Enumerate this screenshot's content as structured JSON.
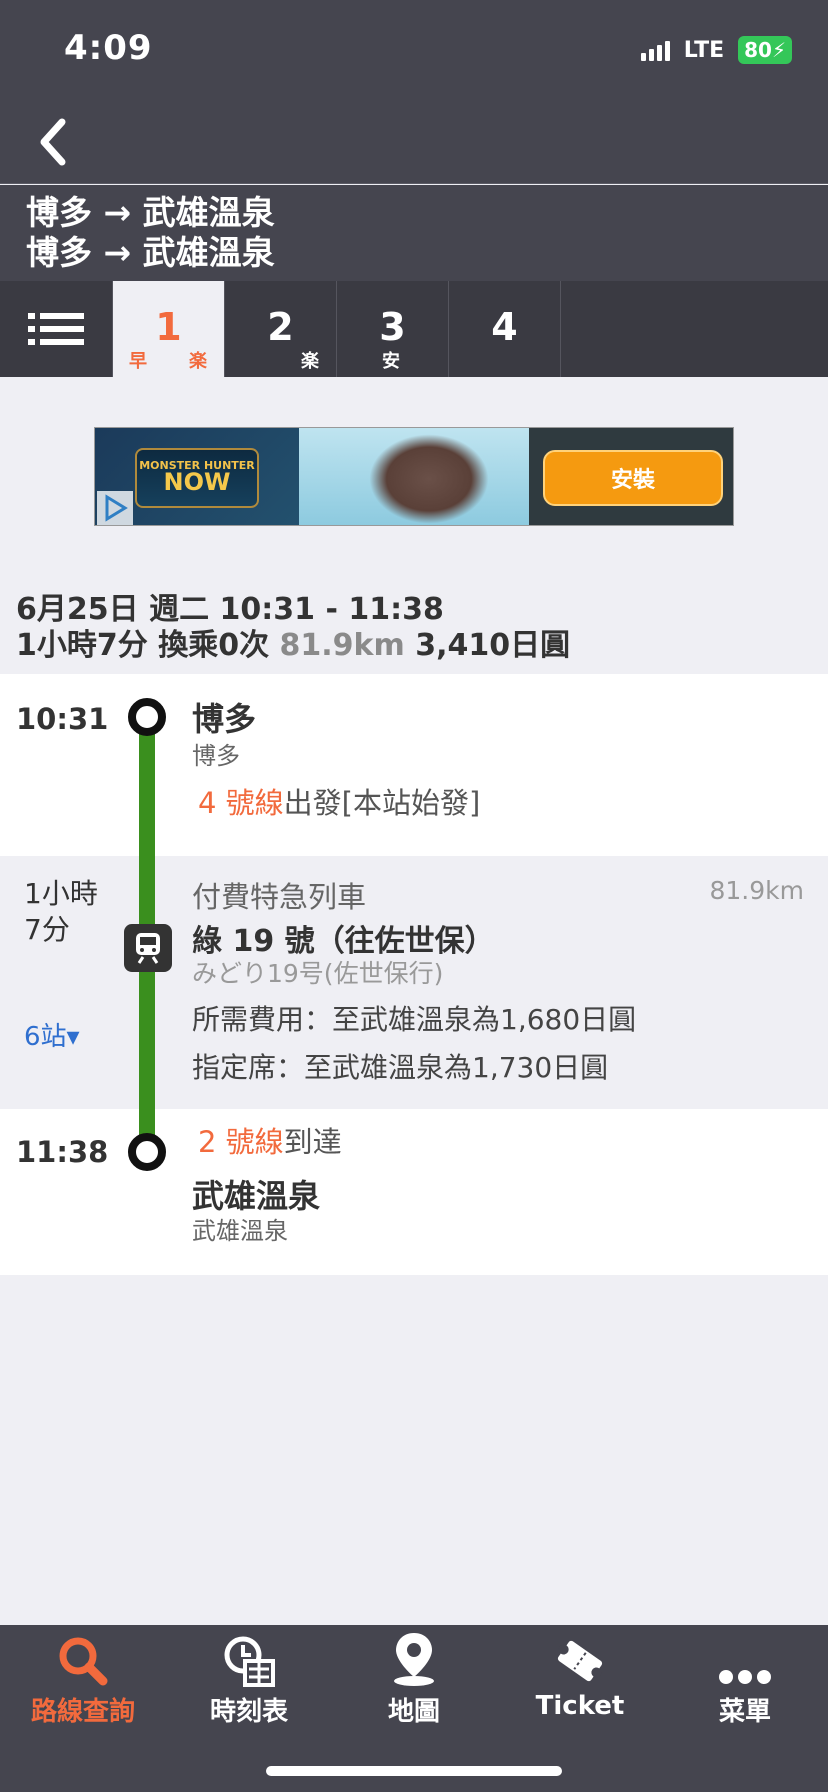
{
  "status_bar": {
    "time": "4:09",
    "network": "LTE",
    "battery": "80"
  },
  "header": {
    "back_icon": "chevron-left-icon",
    "title_line1": "博多 → 武雄溫泉",
    "title_line2": "博多 → 武雄溫泉"
  },
  "tabs": [
    {
      "num": "1",
      "tags": [
        "早",
        "楽"
      ],
      "active": true
    },
    {
      "num": "2",
      "tags": [
        "楽"
      ],
      "active": false
    },
    {
      "num": "3",
      "tags": [
        "安"
      ],
      "active": false
    },
    {
      "num": "4",
      "tags": [],
      "active": false
    }
  ],
  "ad": {
    "logo_top": "MONSTER HUNTER",
    "logo_main": "NOW",
    "install_label": "安裝"
  },
  "summary": {
    "date_line": "6月25日 週二 10:31 - 11:38",
    "duration": "1小時7分",
    "transfers": "換乘0次",
    "distance": "81.9km",
    "fare": "3,410日圓"
  },
  "departure": {
    "time": "10:31",
    "station": "博多",
    "station_sub": "博多",
    "platform": "4 號線",
    "platform_text": "出發[本站始發]"
  },
  "ride": {
    "duration_line1": "1小時",
    "duration_line2": "7分",
    "stops": "6站▾",
    "train_type": "付費特急列車",
    "distance": "81.9km",
    "train_name": "綠 19 號（往佐世保）",
    "train_name_jp": "みどり19号(佐世保行)",
    "fare_line": "所需費用：至武雄溫泉為1,680日圓",
    "reserved_line": "指定席：至武雄溫泉為1,730日圓"
  },
  "arrival": {
    "time": "11:38",
    "platform": "2 號線",
    "platform_text": "到達",
    "station": "武雄溫泉",
    "station_sub": "武雄溫泉"
  },
  "bottom_nav": [
    {
      "label": "路線查詢",
      "icon": "search-icon",
      "active": true
    },
    {
      "label": "時刻表",
      "icon": "timetable-icon",
      "active": false
    },
    {
      "label": "地圖",
      "icon": "map-pin-icon",
      "active": false
    },
    {
      "label": "Ticket",
      "icon": "ticket-icon",
      "active": false
    },
    {
      "label": "菜單",
      "icon": "more-icon",
      "active": false
    }
  ],
  "colors": {
    "accent": "#f26a3d",
    "header": "#45454f",
    "route_line": "#3a8f1e",
    "link": "#2f6fcf"
  }
}
